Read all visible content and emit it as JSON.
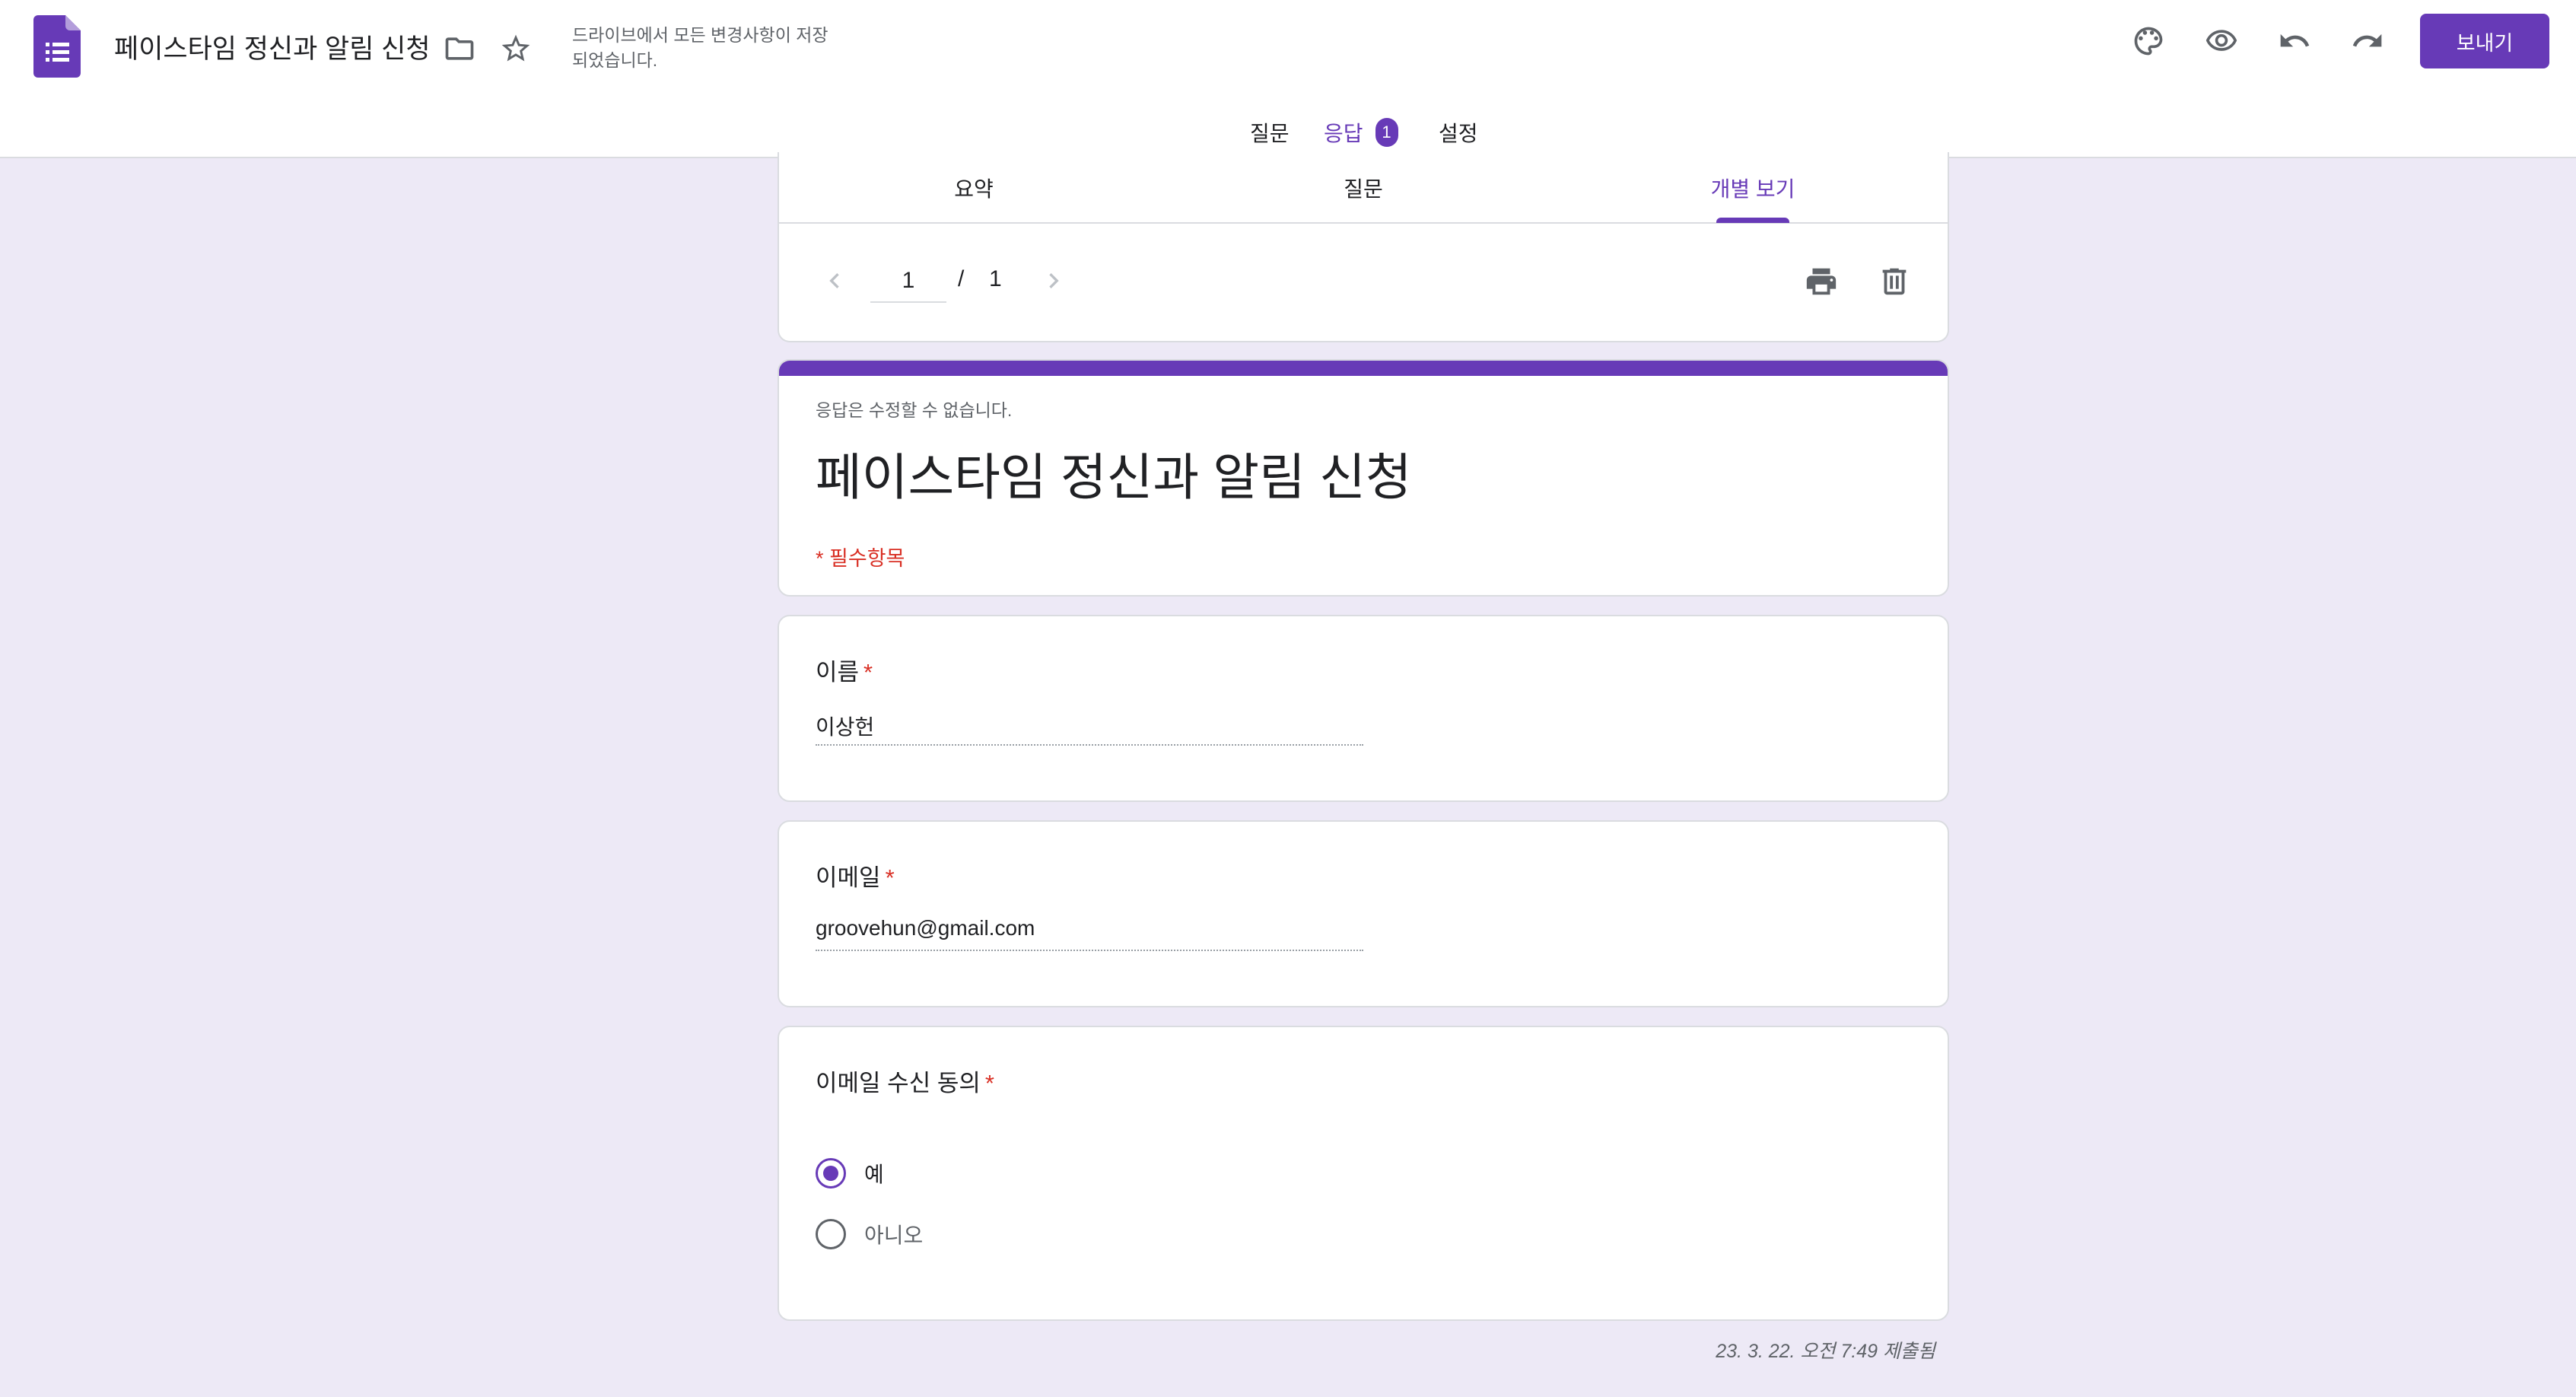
{
  "header": {
    "doc_title": "페이스타임 정신과 알림 신청",
    "save_status": "드라이브에서 모든 변경사항이 저장되었습니다.",
    "send_label": "보내기"
  },
  "main_tabs": [
    {
      "label": "질문",
      "active": false
    },
    {
      "label": "응답",
      "active": true,
      "badge": "1"
    },
    {
      "label": "설정",
      "active": false
    }
  ],
  "response_tabs": [
    {
      "label": "요약",
      "active": false
    },
    {
      "label": "질문",
      "active": false
    },
    {
      "label": "개별 보기",
      "active": true
    }
  ],
  "pager": {
    "current": "1",
    "separator": "/",
    "total": "1"
  },
  "form": {
    "note": "응답은 수정할 수 없습니다.",
    "title": "페이스타임 정신과 알림 신청",
    "required_note": "* 필수항목"
  },
  "questions": [
    {
      "label": "이름",
      "required_mark": "*",
      "answer": "이상헌"
    },
    {
      "label": "이메일",
      "required_mark": "*",
      "answer": "groovehun@gmail.com"
    },
    {
      "label": "이메일 수신 동의",
      "required_mark": "*",
      "options": [
        {
          "label": "예",
          "selected": true
        },
        {
          "label": "아니오",
          "selected": false
        }
      ]
    }
  ],
  "submitted": "23. 3. 22. 오전 7:49 제출됨",
  "colors": {
    "accent": "#673ab7",
    "background": "#ede9f6",
    "required": "#d93025"
  }
}
